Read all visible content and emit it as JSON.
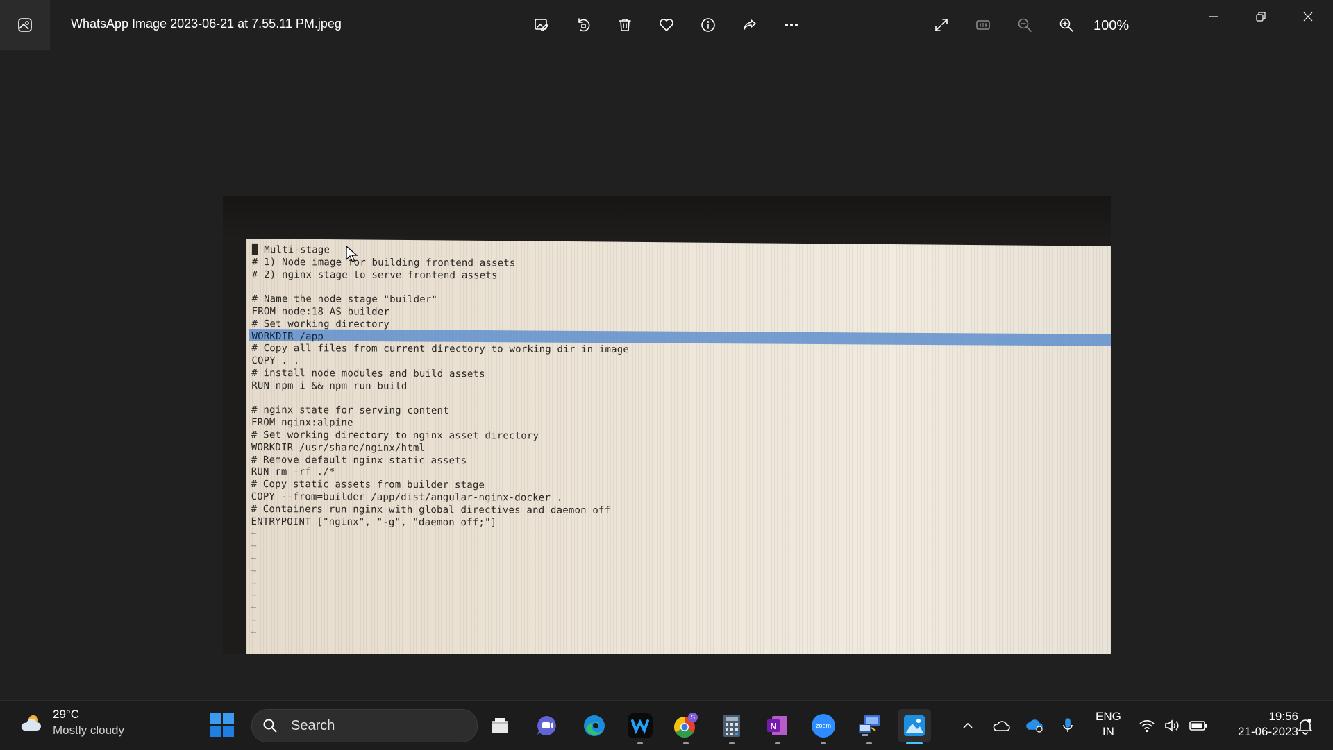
{
  "titlebar": {
    "file_name": "WhatsApp Image 2023-06-21 at 7.55.11 PM.jpeg",
    "zoom": "100%",
    "tool_icons": [
      "edit-image-icon",
      "rotate-icon",
      "delete-icon",
      "favorite-icon",
      "info-icon",
      "share-icon",
      "more-icon"
    ],
    "view_icons": [
      "fullscreen-icon",
      "actual-size-icon",
      "zoom-out-icon",
      "zoom-in-icon"
    ]
  },
  "photo": {
    "code_lines": [
      "█ Multi-stage",
      "# 1) Node image for building frontend assets",
      "# 2) nginx stage to serve frontend assets",
      "",
      "# Name the node stage \"builder\"",
      "FROM node:18 AS builder",
      "# Set working directory",
      "WORKDIR /app",
      "# Copy all files from current directory to working dir in image",
      "COPY . .",
      "# install node modules and build assets",
      "RUN npm i && npm run build",
      "",
      "# nginx state for serving content",
      "FROM nginx:alpine",
      "# Set working directory to nginx asset directory",
      "WORKDIR /usr/share/nginx/html",
      "# Remove default nginx static assets",
      "RUN rm -rf ./*",
      "# Copy static assets from builder stage",
      "COPY --from=builder /app/dist/angular-nginx-docker .",
      "# Containers run nginx with global directives and daemon off",
      "ENTRYPOINT [\"nginx\", \"-g\", \"daemon off;\"]",
      "~",
      "~",
      "~",
      "~",
      "~",
      "~",
      "~",
      "~",
      "~"
    ]
  },
  "taskbar": {
    "weather_temp": "29°C",
    "weather_condition": "Mostly cloudy",
    "search_placeholder": "Search",
    "apps": [
      "file-explorer",
      "teams",
      "edge",
      "webex",
      "chrome",
      "calculator",
      "onenote",
      "zoom",
      "remote-desktop",
      "photos"
    ],
    "zoom_app_label": "zoom",
    "lang_primary": "ENG",
    "lang_region": "IN",
    "time": "19:56",
    "date": "21-06-2023"
  },
  "colors": {
    "background": "#202020",
    "taskbar": "#1c1c1c",
    "selection": "#5f8fcc",
    "accent": "#4cc2ff"
  }
}
